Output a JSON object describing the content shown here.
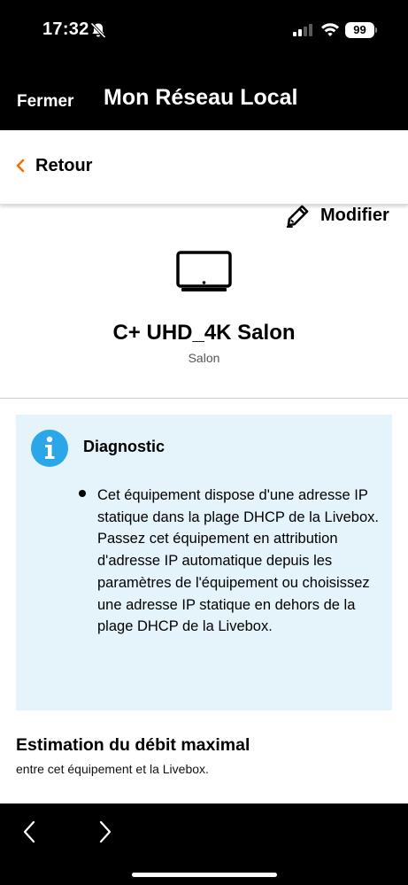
{
  "status_bar": {
    "time": "17:32",
    "battery": "99",
    "icons": [
      "bell-slash-icon",
      "cellular-signal-icon",
      "wifi-icon",
      "battery-icon"
    ]
  },
  "header": {
    "close_label": "Fermer",
    "title": "Mon Réseau Local"
  },
  "back_bar": {
    "back_label": "Retour",
    "icon": "chevron-left-icon",
    "accent_color": "#f16e00"
  },
  "device": {
    "modify_label": "Modifier",
    "modify_icon": "pencil-icon",
    "device_icon": "tv-icon",
    "name": "C+ UHD_4K Salon",
    "room": "Salon"
  },
  "diagnostic": {
    "title": "Diagnostic",
    "icon": "info-icon",
    "icon_color": "#2ba6e8",
    "background_color": "#e5f3fb",
    "message_line1": "Cet équipement dispose d'une adresse IP statique dans la plage DHCP de la Livebox.",
    "message_line2": "Passez cet équipement en attribution d'adresse IP automatique depuis les paramètres de l'équipement ou choisissez une adresse IP statique en dehors de la plage DHCP de la Livebox."
  },
  "estimation": {
    "title": "Estimation du débit maximal",
    "subtitle": "entre cet équipement et la Livebox."
  },
  "browser_bar": {
    "back_icon": "chevron-left-icon",
    "forward_icon": "chevron-right-icon"
  }
}
